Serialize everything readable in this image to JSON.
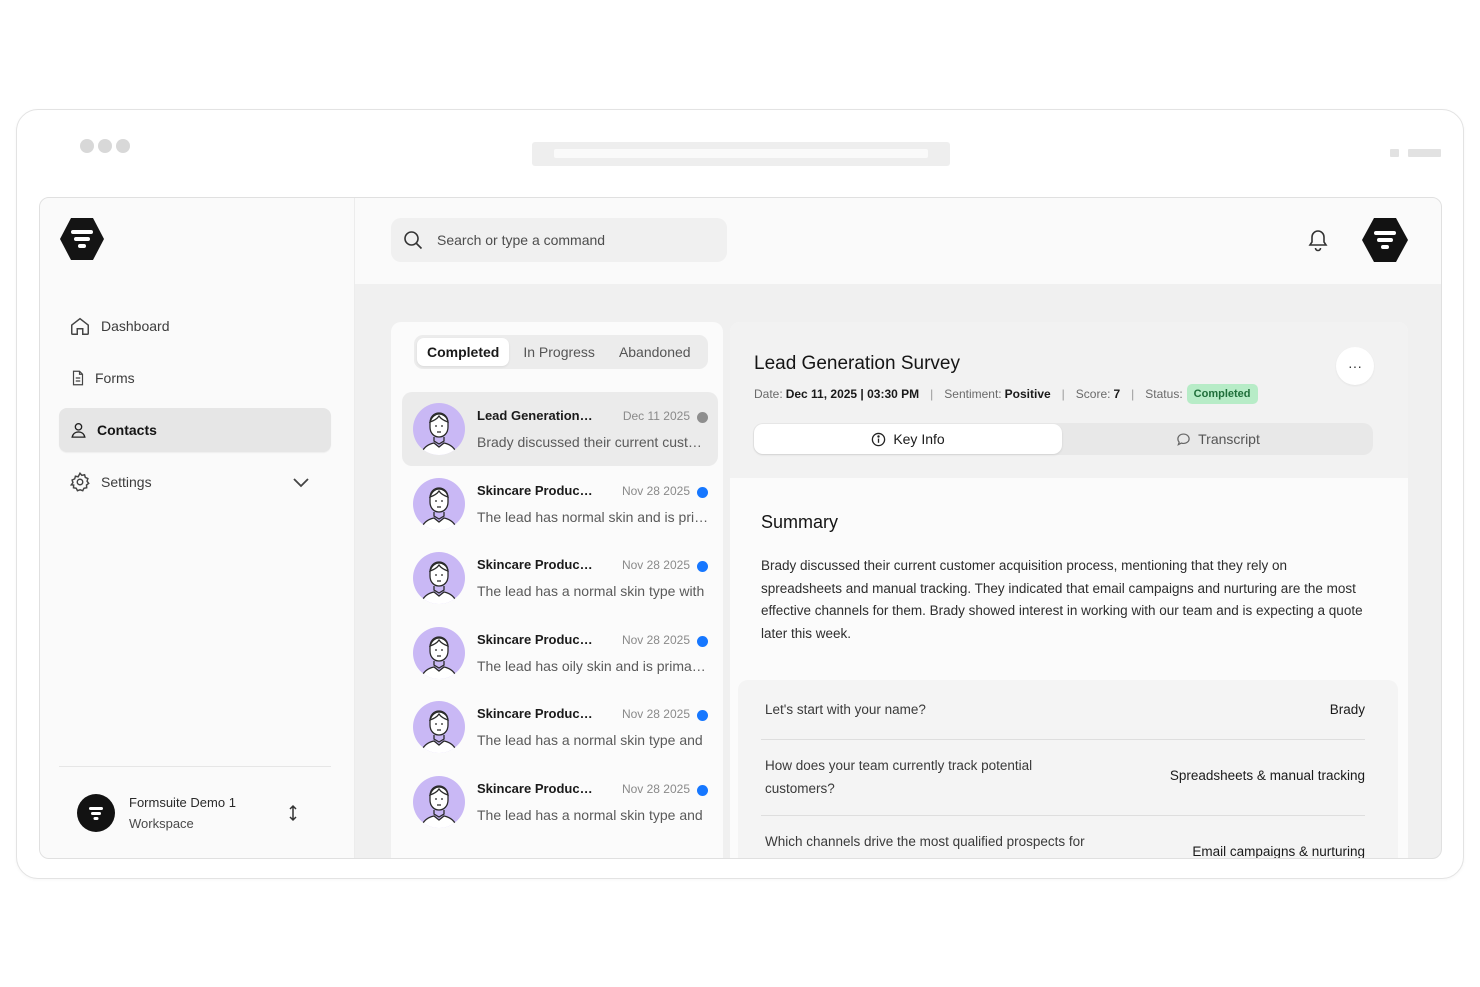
{
  "app": {
    "search": {
      "placeholder": "Search or type a command"
    },
    "nav": [
      {
        "label": "Dashboard",
        "icon": "home-icon"
      },
      {
        "label": "Forms",
        "icon": "document-icon"
      },
      {
        "label": "Contacts",
        "icon": "user-icon",
        "active": true
      },
      {
        "label": "Settings",
        "icon": "gear-icon"
      }
    ],
    "workspace": {
      "name": "Formsuite Demo 1",
      "sub": "Workspace"
    }
  },
  "list": {
    "tabs": [
      "Completed",
      "In Progress",
      "Abandoned"
    ],
    "items": [
      {
        "title": "Lead Generation Survey",
        "date": "Dec 11 2025",
        "preview": "Brady discussed their current customer acquisition process",
        "read": true
      },
      {
        "title": "Skincare Product Survey",
        "date": "Nov 28 2025",
        "preview": "The lead has normal skin and is primarily",
        "read": false
      },
      {
        "title": "Skincare Product Survey",
        "date": "Nov 28 2025",
        "preview": "The lead has a normal skin type with",
        "read": false
      },
      {
        "title": "Skincare Product Survey",
        "date": "Nov 28 2025",
        "preview": "The lead has oily skin and is primarily",
        "read": false
      },
      {
        "title": "Skincare Product Survey",
        "date": "Nov 28 2025",
        "preview": "The lead has a normal skin type and",
        "read": false
      },
      {
        "title": "Skincare Product Survey",
        "date": "Nov 28 2025",
        "preview": "The lead has a normal skin type and",
        "read": false
      }
    ]
  },
  "detail": {
    "title": "Lead Generation Survey",
    "more_label": "···",
    "date_label": "Date:",
    "date_value": "Dec 11, 2025 | 03:30 PM",
    "sentiment_label": "Sentiment:",
    "sentiment_value": "Positive",
    "score_label": "Score:",
    "score_value": "7",
    "status_label": "Status:",
    "status_value": "Completed",
    "tab_key_info": "Key Info",
    "tab_transcript": "Transcript",
    "summary_title": "Summary",
    "summary_text": "Brady discussed their current customer acquisition process, mentioning that they rely on spreadsheets and manual tracking. They indicated that email campaigns and nurturing are the most effective channels for them. Brady showed interest in working with our team and is expecting a quote later this week.",
    "qa": [
      {
        "q": "Let's start with your name?",
        "a": "Brady"
      },
      {
        "q": "How does your team currently track potential customers?",
        "a": "Spreadsheets & manual tracking"
      },
      {
        "q": "Which channels drive the most qualified prospects for",
        "a": "Email campaigns & nurturing"
      }
    ]
  },
  "colors": {
    "accent": "#1677ff",
    "badge_bg": "#b7ecc7",
    "avatar_bg": "#c9b8f5",
    "brand": "#121212"
  }
}
